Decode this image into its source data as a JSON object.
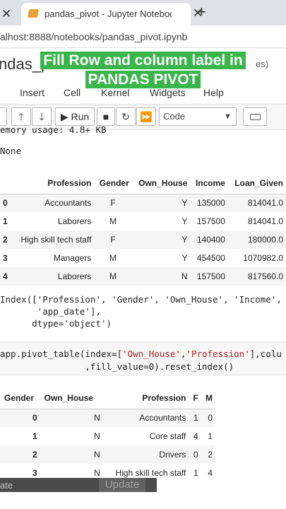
{
  "browser": {
    "tabs": [
      {
        "title": ""
      },
      {
        "title": "pandas_pivot - Jupyter Notebook"
      }
    ],
    "new_tab_symbol": "+",
    "close_symbol": "✕",
    "url": "alhost:8888/notebooks/pandas_pivot.ipynb"
  },
  "notebook": {
    "name": "ndas_pi",
    "save_status": "es)"
  },
  "overlay": {
    "line1": "Fill Row and column label in",
    "line2": "PANDAS PIVOT"
  },
  "menu": [
    "Insert",
    "Cell",
    "Kernel",
    "Widgets",
    "Help"
  ],
  "toolbar": {
    "run_label": "Run",
    "cell_type": "Code"
  },
  "cell1": {
    "memory_line": "emory usage: 4.8+ KB",
    "none_line": "None"
  },
  "table1": {
    "columns": [
      "Profession",
      "Gender",
      "Own_House",
      "Income",
      "Loan_Given"
    ],
    "rows": [
      {
        "idx": "0",
        "cells": [
          "Accountants",
          "F",
          "Y",
          "135000",
          "814041.0"
        ]
      },
      {
        "idx": "1",
        "cells": [
          "Laborers",
          "M",
          "Y",
          "157500",
          "814041.0"
        ]
      },
      {
        "idx": "2",
        "cells": [
          "High skill tech staff",
          "F",
          "Y",
          "140400",
          "180000.0"
        ]
      },
      {
        "idx": "3",
        "cells": [
          "Managers",
          "M",
          "Y",
          "454500",
          "1070982.0"
        ]
      },
      {
        "idx": "4",
        "cells": [
          "Laborers",
          "M",
          "N",
          "157500",
          "817560.0"
        ]
      }
    ]
  },
  "index_output": {
    "line1": "Index(['Profession', 'Gender', 'Own_House', 'Income',",
    "line2": "       'app_date'],",
    "line3": "      dtype='object')"
  },
  "code2": {
    "l1_prefix": "app.pivot_table(index=[",
    "l1_s1": "'Own_House'",
    "l1_comma": ",",
    "l1_s2": "'Profession'",
    "l1_suffix": "],colu",
    "line2": "                ,fill_value=0).reset_index()"
  },
  "table2": {
    "columns": [
      "Gender",
      "Own_House",
      "Profession",
      "F",
      "M"
    ],
    "rows": [
      {
        "cells": [
          "0",
          "N",
          "Accountants",
          "1",
          "0"
        ]
      },
      {
        "cells": [
          "1",
          "N",
          "Core staff",
          "4",
          "1"
        ]
      },
      {
        "cells": [
          "2",
          "N",
          "Drivers",
          "0",
          "2"
        ]
      },
      {
        "cells": [
          "3",
          "N",
          "High skill tech staff",
          "1",
          "4"
        ]
      }
    ]
  },
  "bottom": {
    "left_text": "ate",
    "button_text": "Update"
  }
}
